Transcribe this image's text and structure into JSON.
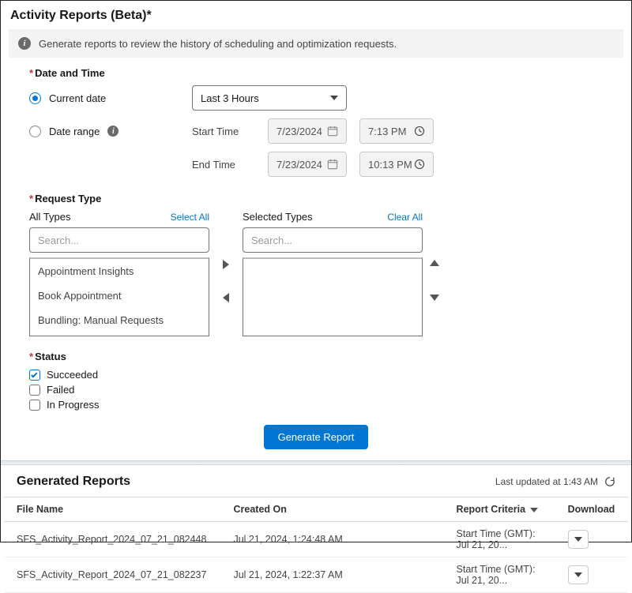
{
  "title": "Activity Reports (Beta)*",
  "banner": "Generate reports to review the history of scheduling and optimization requests.",
  "date_time": {
    "section_label": "Date and Time",
    "current_date_label": "Current date",
    "date_range_label": "Date range",
    "range_select": "Last 3 Hours",
    "start_time_label": "Start Time",
    "end_time_label": "End Time",
    "start_date": "7/23/2024",
    "start_time": "7:13 PM",
    "end_date": "7/23/2024",
    "end_time": "10:13 PM"
  },
  "request_type": {
    "section_label": "Request Type",
    "all_label": "All Types",
    "select_all": "Select All",
    "selected_label": "Selected Types",
    "clear_all": "Clear All",
    "search_placeholder": "Search...",
    "available": [
      "Appointment Insights",
      "Book Appointment",
      "Bundling: Manual Requests"
    ]
  },
  "status": {
    "section_label": "Status",
    "succeeded": "Succeeded",
    "failed": "Failed",
    "in_progress": "In Progress"
  },
  "generate_button": "Generate Report",
  "generated": {
    "title": "Generated Reports",
    "last_updated": "Last updated at 1:43 AM",
    "columns": {
      "file_name": "File Name",
      "created_on": "Created On",
      "report_criteria": "Report Criteria",
      "download": "Download"
    },
    "rows": [
      {
        "file_name": "SFS_Activity_Report_2024_07_21_082448",
        "created_on": "Jul 21, 2024, 1:24:48 AM",
        "criteria": "Start Time (GMT): Jul 21, 20..."
      },
      {
        "file_name": "SFS_Activity_Report_2024_07_21_082237",
        "created_on": "Jul 21, 2024, 1:22:37 AM",
        "criteria": "Start Time (GMT): Jul 21, 20..."
      }
    ]
  }
}
